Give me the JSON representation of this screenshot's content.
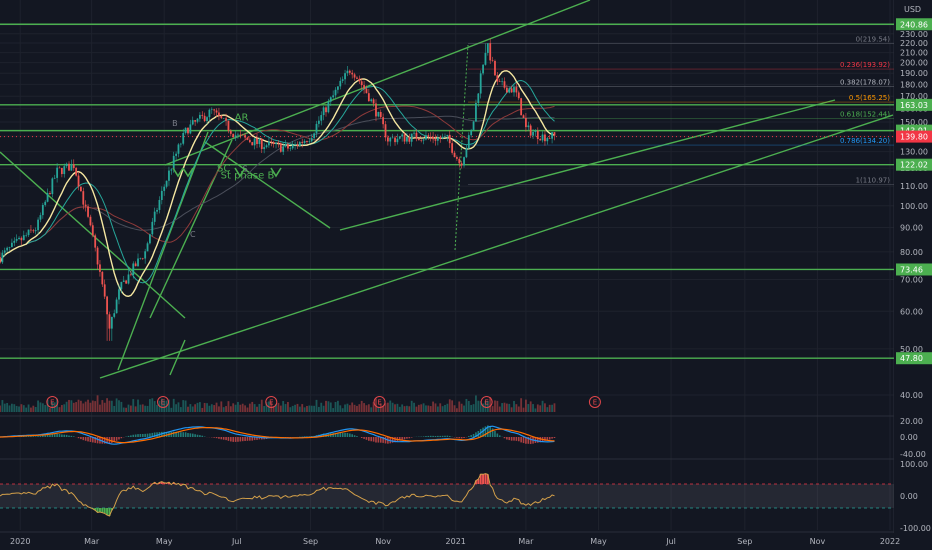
{
  "chart_data": {
    "type": "candlestick",
    "currency": "USD",
    "price_axis": {
      "scale": "log",
      "ticks": [
        40,
        50,
        60,
        70,
        80,
        90,
        100,
        110,
        120,
        130,
        140,
        150,
        160,
        170,
        180,
        190,
        200,
        210,
        220,
        230,
        240
      ],
      "labels": [
        "40.00",
        "50.00",
        "60.00",
        "70.00",
        "80.00",
        "90.00",
        "100.00",
        "110.00",
        "120.00",
        "130.00",
        "140.00",
        "150.00",
        "160.00",
        "170.00",
        "180.00",
        "190.00",
        "200.00",
        "210.00",
        "220.00",
        "230.00",
        "240.00"
      ]
    },
    "time_axis": {
      "start": "2019-12-15",
      "end": "2022-01-01",
      "labels": [
        {
          "date": "2020-01-01",
          "text": "2020"
        },
        {
          "date": "2020-03-01",
          "text": "Mar"
        },
        {
          "date": "2020-05-01",
          "text": "May"
        },
        {
          "date": "2020-07-01",
          "text": "Jul"
        },
        {
          "date": "2020-09-01",
          "text": "Sep"
        },
        {
          "date": "2020-11-01",
          "text": "Nov"
        },
        {
          "date": "2021-01-01",
          "text": "2021"
        },
        {
          "date": "2021-03-01",
          "text": "Mar"
        },
        {
          "date": "2021-05-01",
          "text": "May"
        },
        {
          "date": "2021-07-01",
          "text": "Jul"
        },
        {
          "date": "2021-09-01",
          "text": "Sep"
        },
        {
          "date": "2021-11-01",
          "text": "Nov"
        },
        {
          "date": "2022-01-01",
          "text": "2022"
        }
      ]
    },
    "price_keypoints": [
      {
        "date": "2019-12-15",
        "price": 78
      },
      {
        "date": "2020-01-15",
        "price": 90
      },
      {
        "date": "2020-02-01",
        "price": 118
      },
      {
        "date": "2020-02-15",
        "price": 122
      },
      {
        "date": "2020-02-24",
        "price": 100
      },
      {
        "date": "2020-03-16",
        "price": 55
      },
      {
        "date": "2020-03-25",
        "price": 67
      },
      {
        "date": "2020-04-15",
        "price": 80
      },
      {
        "date": "2020-05-01",
        "price": 110
      },
      {
        "date": "2020-05-20",
        "price": 145
      },
      {
        "date": "2020-06-10",
        "price": 158
      },
      {
        "date": "2020-07-01",
        "price": 140
      },
      {
        "date": "2020-07-20",
        "price": 135
      },
      {
        "date": "2020-08-15",
        "price": 132
      },
      {
        "date": "2020-09-01",
        "price": 140
      },
      {
        "date": "2020-09-20",
        "price": 170
      },
      {
        "date": "2020-10-05",
        "price": 195
      },
      {
        "date": "2020-10-20",
        "price": 170
      },
      {
        "date": "2020-11-05",
        "price": 138
      },
      {
        "date": "2020-12-01",
        "price": 140
      },
      {
        "date": "2020-12-25",
        "price": 138
      },
      {
        "date": "2021-01-05",
        "price": 122
      },
      {
        "date": "2021-01-15",
        "price": 145
      },
      {
        "date": "2021-01-27",
        "price": 219
      },
      {
        "date": "2021-02-05",
        "price": 180
      },
      {
        "date": "2021-02-20",
        "price": 175
      },
      {
        "date": "2021-03-01",
        "price": 145
      },
      {
        "date": "2021-03-15",
        "price": 140
      },
      {
        "date": "2021-03-25",
        "price": 139.8
      }
    ],
    "horizontal_levels": [
      {
        "price": 240.86,
        "label": "240.86"
      },
      {
        "price": 163.03,
        "label": "163.03"
      },
      {
        "price": 143.91,
        "label": "143.91"
      },
      {
        "price": 122.02,
        "label": "122.02"
      },
      {
        "price": 73.46,
        "label": "73.46"
      },
      {
        "price": 47.8,
        "label": "47.80"
      }
    ],
    "last_price": {
      "price": 139.8,
      "label": "139.80"
    },
    "fibonacci": [
      {
        "ratio": "0",
        "price": 219.54,
        "label": "0(219.54)",
        "color": "#787b86"
      },
      {
        "ratio": "0.236",
        "price": 193.92,
        "label": "0.236(193.92)",
        "color": "#f23645"
      },
      {
        "ratio": "0.382",
        "price": 178.07,
        "label": "0.382(178.07)",
        "color": "#b2b5be"
      },
      {
        "ratio": "0.5",
        "price": 165.25,
        "label": "0.5(165.25)",
        "color": "#ff9800"
      },
      {
        "ratio": "0.618",
        "price": 152.44,
        "label": "0.618(152.44)",
        "color": "#4caf50"
      },
      {
        "ratio": "0.786",
        "price": 134.2,
        "label": "0.786(134.20)",
        "color": "#2196f3"
      },
      {
        "ratio": "1",
        "price": 110.97,
        "label": "1(110.97)",
        "color": "#787b86"
      }
    ],
    "annotations": [
      {
        "text": "St phase B",
        "date": "2020-07-10",
        "price": 114
      },
      {
        "text": "SC",
        "date": "2020-06-20",
        "price": 118
      },
      {
        "text": "AR",
        "date": "2020-07-05",
        "price": 151
      },
      {
        "text": "B",
        "date": "2020-05-10",
        "price": 147
      },
      {
        "text": "C",
        "date": "2020-05-25",
        "price": 86
      },
      {
        "text": "S",
        "date": "2020-07-08",
        "price": 118
      }
    ],
    "earnings_markers": [
      {
        "date": "2020-01-28",
        "label": "E"
      },
      {
        "date": "2020-04-30",
        "label": "E"
      },
      {
        "date": "2020-07-30",
        "label": "E"
      },
      {
        "date": "2020-10-29",
        "label": "E"
      },
      {
        "date": "2021-01-27",
        "label": "E"
      },
      {
        "date": "2021-04-28",
        "label": "E"
      }
    ],
    "macd_axis": {
      "labels": [
        "20.00",
        "0.00",
        "-40.00"
      ]
    },
    "rsi_axis": {
      "labels": [
        "100.00",
        "0.00",
        "-100.00"
      ]
    }
  }
}
